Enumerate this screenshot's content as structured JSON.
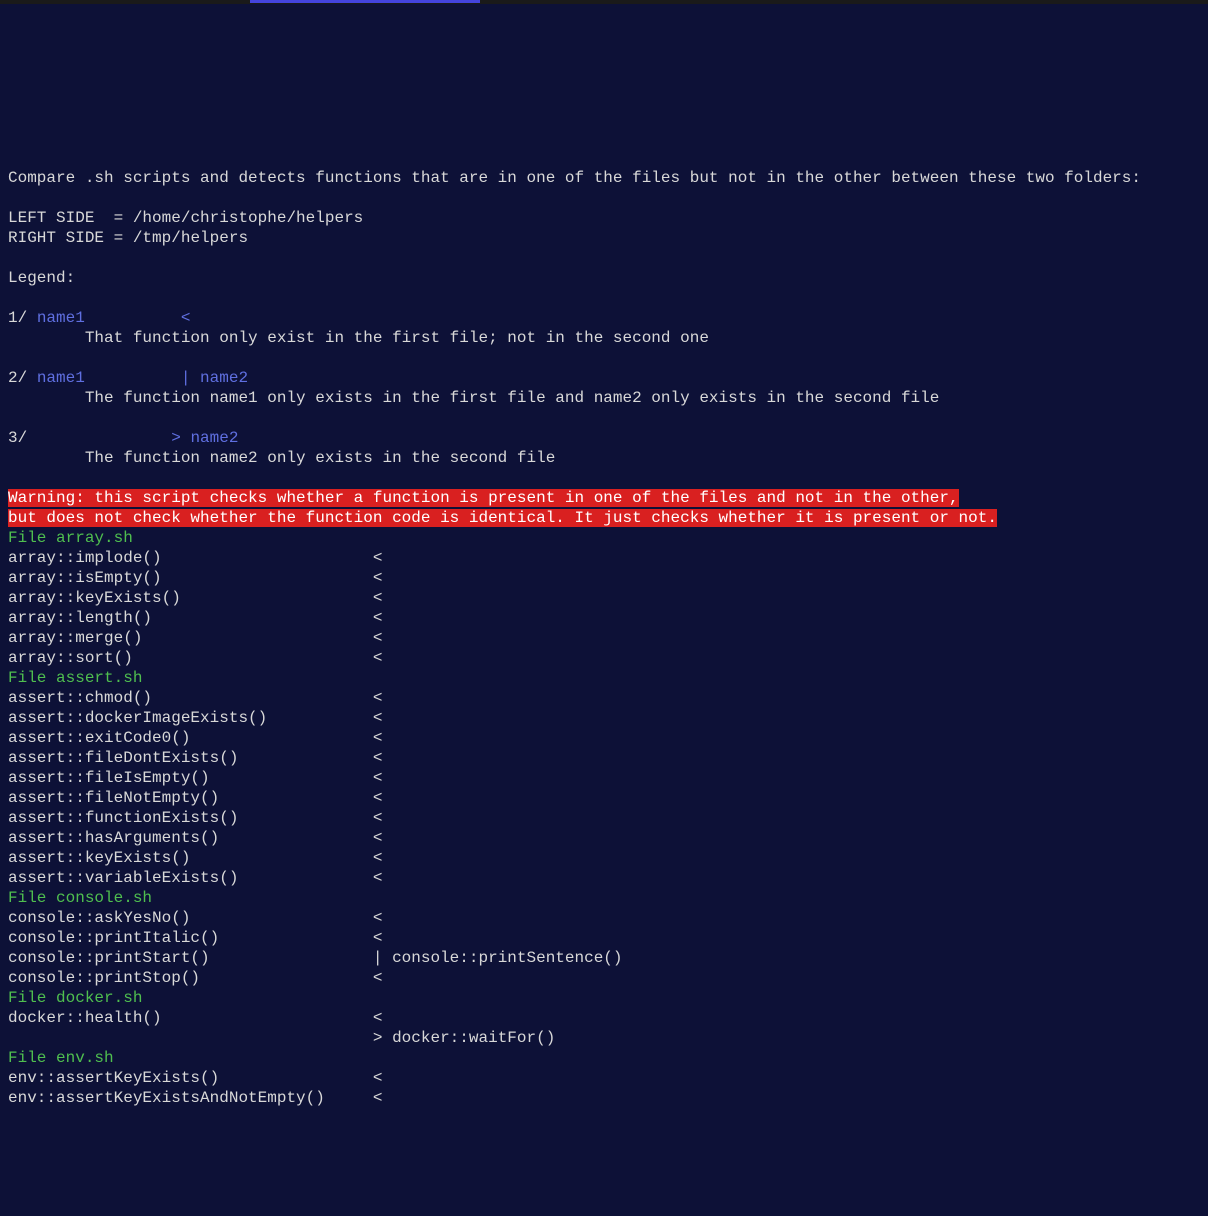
{
  "header": {
    "compare_line": "Compare .sh scripts and detects functions that are in one of the files but not in the other between these two folders:",
    "left_label": "LEFT SIDE  = ",
    "left_path": "/home/christophe/helpers",
    "right_label": "RIGHT SIDE = ",
    "right_path": "/tmp/helpers",
    "legend_title": "Legend:"
  },
  "legend": {
    "l1_prefix": "1/ ",
    "l1_blue": "name1          <",
    "l1_desc": "        That function only exist in the first file; not in the second one",
    "l2_prefix": "2/ ",
    "l2_blue": "name1          | name2",
    "l2_desc": "        The function name1 only exists in the first file and name2 only exists in the second file",
    "l3_prefix": "3/ ",
    "l3_blue": "              > name2",
    "l3_desc": "        The function name2 only exists in the second file"
  },
  "warning": {
    "line1": "Warning: this script checks whether a function is present in one of the files and not in the other,",
    "line2": "but does not check whether the function code is identical. It just checks whether it is present or not."
  },
  "files": [
    {
      "title": "File array.sh",
      "rows": [
        {
          "left": "array::implode()",
          "sep": "<",
          "right": ""
        },
        {
          "left": "array::isEmpty()",
          "sep": "<",
          "right": ""
        },
        {
          "left": "array::keyExists()",
          "sep": "<",
          "right": ""
        },
        {
          "left": "array::length()",
          "sep": "<",
          "right": ""
        },
        {
          "left": "array::merge()",
          "sep": "<",
          "right": ""
        },
        {
          "left": "array::sort()",
          "sep": "<",
          "right": ""
        }
      ]
    },
    {
      "title": "File assert.sh",
      "rows": [
        {
          "left": "assert::chmod()",
          "sep": "<",
          "right": ""
        },
        {
          "left": "assert::dockerImageExists()",
          "sep": "<",
          "right": ""
        },
        {
          "left": "assert::exitCode0()",
          "sep": "<",
          "right": ""
        },
        {
          "left": "assert::fileDontExists()",
          "sep": "<",
          "right": ""
        },
        {
          "left": "assert::fileIsEmpty()",
          "sep": "<",
          "right": ""
        },
        {
          "left": "assert::fileNotEmpty()",
          "sep": "<",
          "right": ""
        },
        {
          "left": "assert::functionExists()",
          "sep": "<",
          "right": ""
        },
        {
          "left": "assert::hasArguments()",
          "sep": "<",
          "right": ""
        },
        {
          "left": "assert::keyExists()",
          "sep": "<",
          "right": ""
        },
        {
          "left": "assert::variableExists()",
          "sep": "<",
          "right": ""
        }
      ]
    },
    {
      "title": "File console.sh",
      "rows": [
        {
          "left": "console::askYesNo()",
          "sep": "<",
          "right": ""
        },
        {
          "left": "console::printItalic()",
          "sep": "<",
          "right": ""
        },
        {
          "left": "console::printStart()",
          "sep": "|",
          "right": "console::printSentence()"
        },
        {
          "left": "console::printStop()",
          "sep": "<",
          "right": ""
        }
      ]
    },
    {
      "title": "File docker.sh",
      "rows": [
        {
          "left": "docker::health()",
          "sep": "<",
          "right": ""
        },
        {
          "left": "",
          "sep": ">",
          "right": "docker::waitFor()"
        }
      ]
    },
    {
      "title": "File env.sh",
      "rows": [
        {
          "left": "env::assertKeyExists()",
          "sep": "<",
          "right": ""
        },
        {
          "left": "env::assertKeyExistsAndNotEmpty()",
          "sep": "<",
          "right": ""
        }
      ]
    }
  ]
}
